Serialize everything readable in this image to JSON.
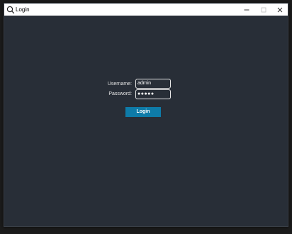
{
  "window": {
    "title": "Login",
    "app_icon": "search-icon",
    "controls": {
      "minimize_icon": "minimize-icon",
      "maximize_icon": "maximize-icon",
      "close_icon": "close-icon"
    }
  },
  "form": {
    "username_label": "Username:",
    "username_value": "admin",
    "password_label": "Password:",
    "password_value": "●●●●●",
    "login_button": "Login"
  },
  "colors": {
    "background": "#282e37",
    "button": "#0e7ba8",
    "titlebar": "#ffffff"
  }
}
